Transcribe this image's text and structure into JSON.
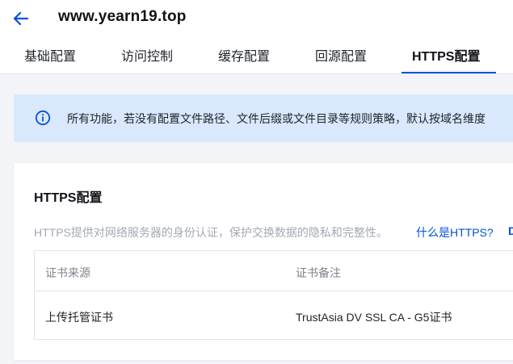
{
  "header": {
    "domain": "www.yearn19.top",
    "back_icon": "arrow-left-icon"
  },
  "tabs": [
    {
      "label": "基础配置",
      "active": false
    },
    {
      "label": "访问控制",
      "active": false
    },
    {
      "label": "缓存配置",
      "active": false
    },
    {
      "label": "回源配置",
      "active": false
    },
    {
      "label": "HTTPS配置",
      "active": true
    }
  ],
  "notice": {
    "icon": "info-icon",
    "text": "所有功能，若没有配置文件路径、文件后缀或文件目录等规则策略，默认按域名维度"
  },
  "https_card": {
    "title": "HTTPS配置",
    "description": "HTTPS提供对网络服务器的身份认证，保护交换数据的隐私和完整性。",
    "link": "什么是HTTPS?",
    "link_2": "D",
    "table": {
      "columns": [
        "证书来源",
        "证书备注"
      ],
      "rows": [
        [
          "上传托管证书",
          "TrustAsia DV SSL CA - G5证书"
        ]
      ]
    }
  },
  "colors": {
    "accent": "#0052d9",
    "notice_bg": "#d9e8fd",
    "page_bg": "#f3f4f7"
  }
}
